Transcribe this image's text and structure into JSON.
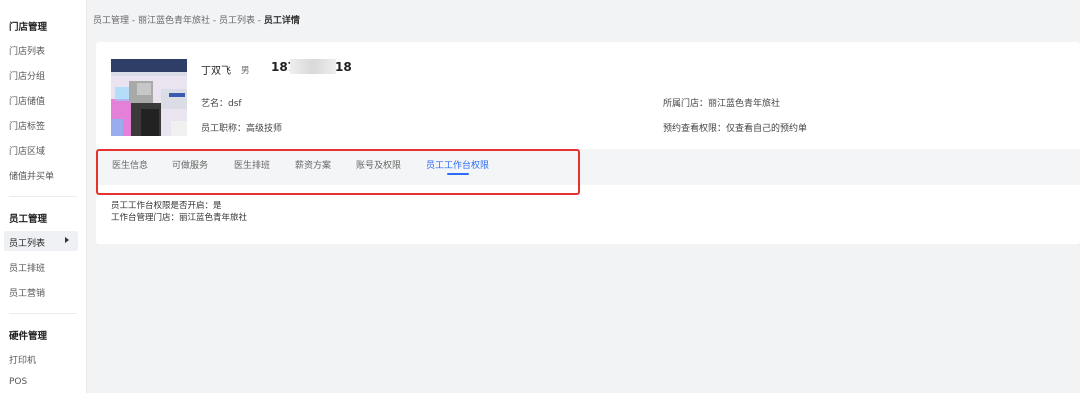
{
  "sidebar": {
    "groups": [
      {
        "title": "门店管理",
        "items": [
          "门店列表",
          "门店分组",
          "门店储值",
          "门店标签",
          "门店区域",
          "储值并买单"
        ]
      },
      {
        "title": "员工管理",
        "items": [
          "员工列表",
          "员工排班",
          "员工营销"
        ]
      },
      {
        "title": "硬件管理",
        "items": [
          "打印机",
          "POS"
        ]
      }
    ],
    "active_item": "员工列表"
  },
  "breadcrumb": {
    "path": "员工管理 - 丽江蓝色青年旅社 - 员工列表 - ",
    "current": "员工详情"
  },
  "employee": {
    "name": "丁双飞",
    "gender": "男",
    "phone_prefix": "187",
    "phone_suffix": "18",
    "stage_name": "艺名：dsf",
    "title": "员工职称：高级技师",
    "store": "所属门店：丽江蓝色青年旅社",
    "booking_permission": "预约查看权限：仅查看自己的预约单"
  },
  "tabs": [
    {
      "label": "医生信息",
      "active": false
    },
    {
      "label": "可做服务",
      "active": false
    },
    {
      "label": "医生排班",
      "active": false
    },
    {
      "label": "薪资方案",
      "active": false
    },
    {
      "label": "账号及权限",
      "active": false
    },
    {
      "label": "员工工作台权限",
      "active": true
    }
  ],
  "workbench": {
    "enabled_line": "员工工作台权限是否开启：是",
    "store_line": "工作台管理门店：丽江蓝色青年旅社"
  },
  "colors": {
    "accent": "#2d6cf6",
    "highlight": "#e5322d",
    "background": "#f2f3f5"
  }
}
